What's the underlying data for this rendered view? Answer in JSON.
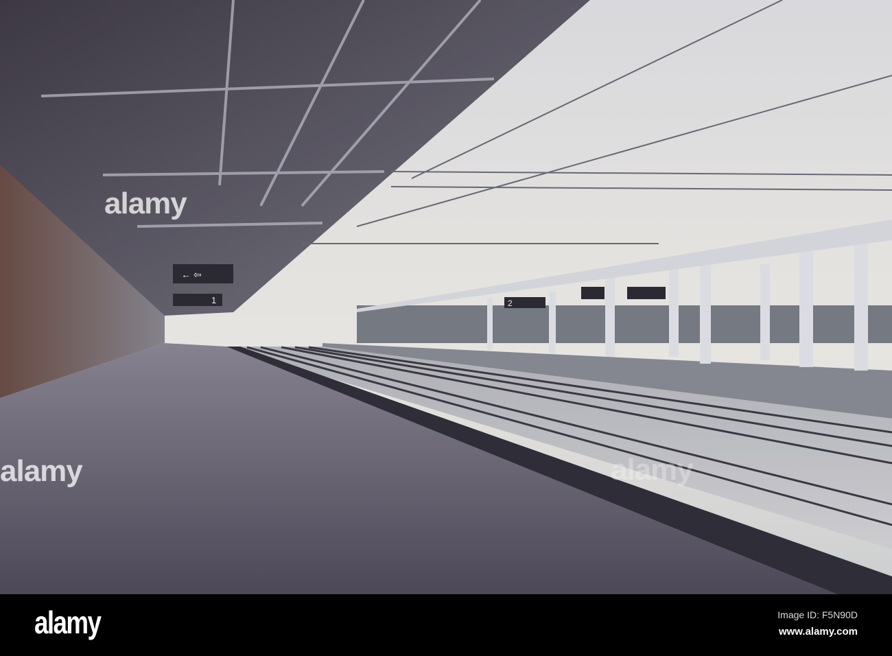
{
  "photo": {
    "subject": "empty railway station platform with tracks",
    "signs": [
      "1",
      "2"
    ]
  },
  "watermark": {
    "text": "alamy"
  },
  "footer": {
    "logo": "alamy",
    "image_id": "Image ID: F5N90D",
    "website": "www.alamy.com"
  }
}
